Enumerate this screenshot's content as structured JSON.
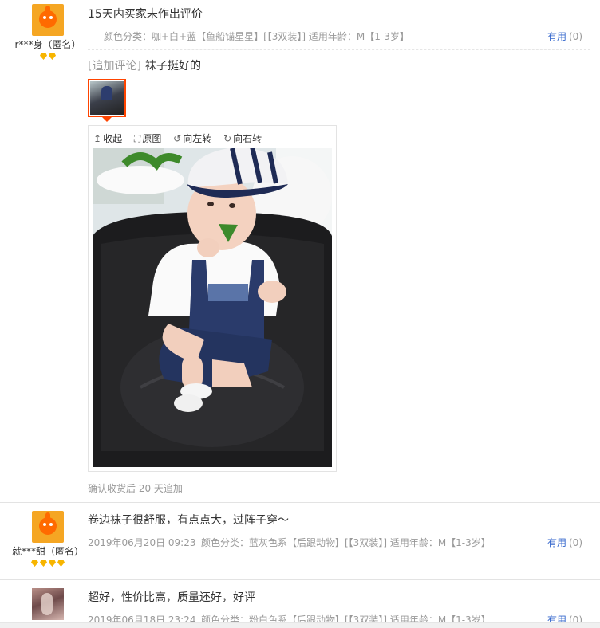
{
  "reviews": [
    {
      "user": "r***身（匿名）",
      "badge_count": 2,
      "text": "15天内买家未作出评价",
      "sku": "颜色分类：咖+白+蓝【鱼船锚星星】[【3双装】]  适用年龄：M【1-3岁】",
      "useful_label": "有用",
      "useful_count": "(0)",
      "append": {
        "label": "[追加评论]",
        "text": "袜子挺好的",
        "viewer_tools": [
          {
            "icon": "collapse-icon",
            "glyph": "↥",
            "label": "收起"
          },
          {
            "icon": "fullsize-icon",
            "glyph": "⛶",
            "label": "原图"
          },
          {
            "icon": "rotate-left-icon",
            "glyph": "↺",
            "label": "向左转"
          },
          {
            "icon": "rotate-right-icon",
            "glyph": "↻",
            "label": "向右转"
          }
        ],
        "followup": "确认收货后 20 天追加"
      }
    },
    {
      "user": "就***甜（匿名）",
      "badge_count": 4,
      "text": "卷边袜子很舒服，有点点大，过阵子穿～",
      "date": "2019年06月20日 09:23",
      "sku": "颜色分类：蓝灰色系【后跟动物】[【3双装】]  适用年龄：M【1-3岁】",
      "useful_label": "有用",
      "useful_count": "(0)"
    },
    {
      "user": "",
      "badge_count": 0,
      "text": "超好，性价比高，质量还好，好评",
      "date": "2019年06月18日 23:24",
      "sku": "颜色分类：粉白色系【后跟动物】[【3双装】]  适用年龄：M【1-3岁】",
      "useful_label": "有用",
      "useful_count": "(0)"
    }
  ],
  "colors": {
    "link": "#3366cc",
    "accent": "#ff4400",
    "muted": "#999999",
    "badge": "#f7b500"
  }
}
